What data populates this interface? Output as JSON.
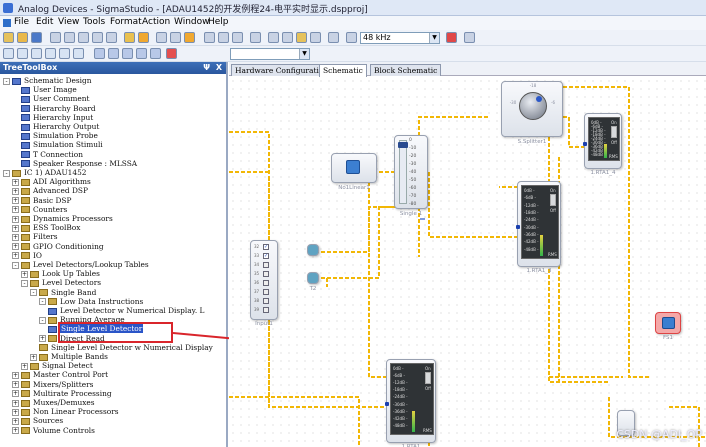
{
  "window": {
    "title": "Analog Devices - SigmaStudio - [ADAU1452的开发例程24-电平实时显示.dspproj]"
  },
  "menu": [
    "File",
    "Edit",
    "View",
    "Tools",
    "Format",
    "Action",
    "Window",
    "Help"
  ],
  "toolbar": {
    "sample_rate": "48 kHz"
  },
  "toolbox": {
    "title": "TreeToolBox",
    "close": "X",
    "pin": "Ψ"
  },
  "tree": [
    {
      "label": "Schematic Design",
      "indent": 0,
      "exp": "-"
    },
    {
      "label": "User Image",
      "indent": 2
    },
    {
      "label": "User Comment",
      "indent": 2
    },
    {
      "label": "Hierarchy Board",
      "indent": 2
    },
    {
      "label": "Hierarchy Input",
      "indent": 2
    },
    {
      "label": "Hierarchy Output",
      "indent": 2
    },
    {
      "label": "Simulation Probe",
      "indent": 2
    },
    {
      "label": "Simulation Stimuli",
      "indent": 2
    },
    {
      "label": "T Connection",
      "indent": 2
    },
    {
      "label": "Speaker Response : MLSSA",
      "indent": 2
    },
    {
      "label": "IC 1) ADAU1452",
      "indent": 0,
      "exp": "-"
    },
    {
      "label": "ADI Algorithms",
      "indent": 1,
      "exp": "+"
    },
    {
      "label": "Advanced DSP",
      "indent": 1,
      "exp": "+"
    },
    {
      "label": "Basic DSP",
      "indent": 1,
      "exp": "+"
    },
    {
      "label": "Counters",
      "indent": 1,
      "exp": "+"
    },
    {
      "label": "Dynamics Processors",
      "indent": 1,
      "exp": "+"
    },
    {
      "label": "ESS ToolBox",
      "indent": 1,
      "exp": "+"
    },
    {
      "label": "Filters",
      "indent": 1,
      "exp": "+"
    },
    {
      "label": "GPIO Conditioning",
      "indent": 1,
      "exp": "+"
    },
    {
      "label": "IO",
      "indent": 1,
      "exp": "+"
    },
    {
      "label": "Level Detectors/Lookup Tables",
      "indent": 1,
      "exp": "-"
    },
    {
      "label": "Look Up Tables",
      "indent": 2,
      "exp": "+"
    },
    {
      "label": "Level Detectors",
      "indent": 2,
      "exp": "-"
    },
    {
      "label": "Single Band",
      "indent": 3,
      "exp": "-"
    },
    {
      "label": "Low Data Instructions",
      "indent": 4,
      "exp": "-"
    },
    {
      "label": "Level Detector w Numerical Display. L",
      "indent": 5
    },
    {
      "label": "Running Average",
      "indent": 4,
      "exp": "-"
    },
    {
      "label": "Single Level Detector",
      "indent": 5,
      "sel": true
    },
    {
      "label": "Direct Read",
      "indent": 4,
      "exp": "+"
    },
    {
      "label": "Single Level Detector w Numerical Display",
      "indent": 4
    },
    {
      "label": "Multiple Bands",
      "indent": 3,
      "exp": "+"
    },
    {
      "label": "Signal Detect",
      "indent": 2,
      "exp": "+"
    },
    {
      "label": "Master Control Port",
      "indent": 1,
      "exp": "+"
    },
    {
      "label": "Mixers/Splitters",
      "indent": 1,
      "exp": "+"
    },
    {
      "label": "Multirate Processing",
      "indent": 1,
      "exp": "+"
    },
    {
      "label": "Muxes/Demuxes",
      "indent": 1,
      "exp": "+"
    },
    {
      "label": "Non Linear Processors",
      "indent": 1,
      "exp": "+"
    },
    {
      "label": "Sources",
      "indent": 1,
      "exp": "+"
    },
    {
      "label": "Volume Controls",
      "indent": 1,
      "exp": "+"
    }
  ],
  "tabs": [
    "Hardware Configuration",
    "Schematic",
    "Block Schematic"
  ],
  "blocks": {
    "splitter": "S.Splitter1",
    "nolinear": "No1Linear1",
    "single": "Single 1",
    "input": "Input1",
    "t2": "T2",
    "rta1": "1.RTA1",
    "rta2": "1.RTA1_2",
    "rta3": "1.RTA1_3",
    "rta4": "1.RTA1_4",
    "fs": "FS1"
  },
  "meter": {
    "ticks": [
      "0dB -",
      "-6dB -",
      "-12dB -",
      "-18dB -",
      "-24dB -",
      "-30dB -",
      "-36dB -",
      "-42dB -",
      "-48dB -"
    ],
    "on": "On",
    "off": "Off",
    "mode": "RMS"
  },
  "vol_scale": [
    "0",
    "-10",
    "-20",
    "-30",
    "-40",
    "-50",
    "-60",
    "-70",
    "-80"
  ],
  "knob": {
    "top": "-18",
    "mid_l": "-30",
    "mid_r": "-6",
    "bot": "-48"
  },
  "input_rows": [
    "32",
    "33",
    "34",
    "35",
    "36",
    "37",
    "38",
    "39"
  ],
  "watermark": "CSDN @ADI_OP"
}
